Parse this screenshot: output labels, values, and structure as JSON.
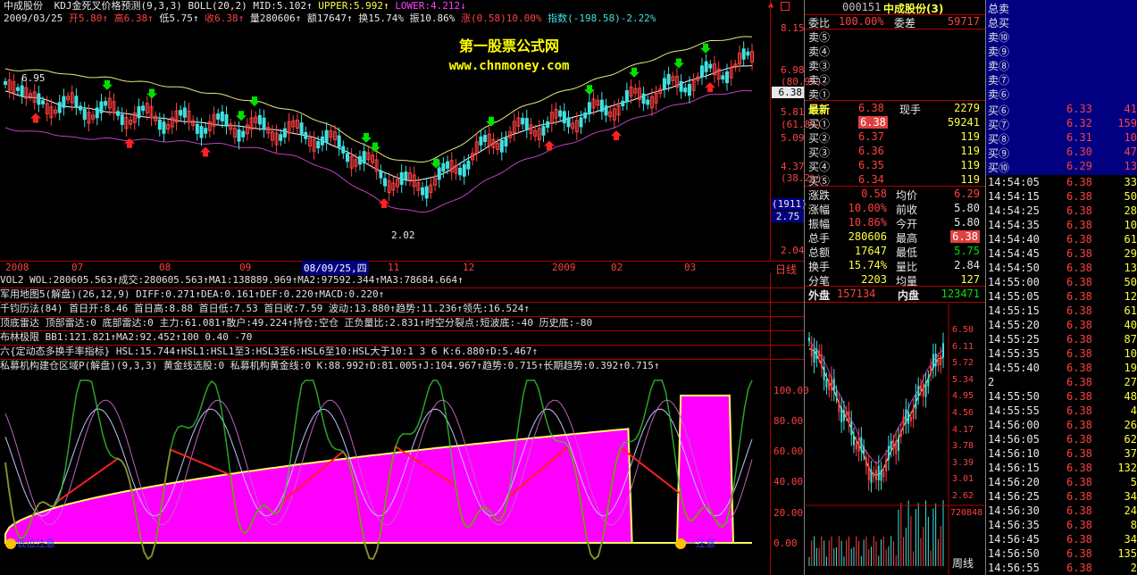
{
  "header": {
    "stock_name": "中成股份",
    "indicator_title": "KDJ金死叉价格预测(9,3,3)",
    "boll": "BOLL(20,2)",
    "mid": "MID:5.102",
    "upper": "UPPER:5.992",
    "lower": "LOWER:4.212",
    "date": "2009/03/25",
    "open": "开5.80",
    "high": "高6.38",
    "low": "低5.75",
    "close": "收6.38",
    "volume": "量280606",
    "amount": "额17647",
    "turnover": "换15.74%",
    "amplitude": "振10.86%",
    "change": "涨(0.58)10.00%",
    "index": "指数(-198.58)-2.22%"
  },
  "watermark": {
    "line1": "第一股票公式网",
    "line2": "www.chnmoney.com"
  },
  "main_chart": {
    "high_label": "6.95",
    "low_label": "2.02",
    "price_axis": [
      "8.15",
      "6.98",
      "(80.9%)",
      "6.38",
      "5.81",
      "(61.8%)",
      "5.09",
      "4.37",
      "(38.2%)",
      "(1911)",
      "2.75",
      "2.04"
    ],
    "time_axis": [
      "2008",
      "07",
      "08",
      "09",
      "08/09/25,四",
      "11",
      "12",
      "2009",
      "02",
      "03"
    ],
    "period": "日线"
  },
  "indicator_lines": [
    "VOL2 WOL:280605.563↑成交:280605.563↑MA1:138889.969↑MA2:97592.344↑MA3:78684.664↑",
    "军用地图5(解盘)(26,12,9) DIFF:0.271↑DEA:0.161↑DEF:0.220↑MACD:0.220↑",
    "千钧历法(84) 首日开:8.46 首日高:8.88 首日低:7.53 首日收:7.59 波动:13.880↑趋势:11.236↑领先:16.524↑",
    "顶底雷达 顶部雷达:0 底部雷达:0 主力:61.081↑散户:49.224↑持仓:空仓 正负量比:2.831↑时空分裂点:短波底:-40 历史底:-80",
    "布林极限 BB1:121.821↑MA2:92.452↑100 0.40 -70",
    "六{定动态多换手率指标} HSL:15.744↑HSL1:HSL1至3:HSL3至6:HSL6至10:HSL大于10:1 3 6 K:6.880↑D:5.467↑",
    "私募机构建仓区域P(解盘)(9,3,3) 黄金线选股:0 私募机构黄金线:0 K:88.992↑D:81.005↑J:104.967↑趋势:0.715↑长期趋势:0.392↑0.715↑"
  ],
  "lower_chart": {
    "axis": [
      "100.00",
      "80.00",
      "60.00",
      "40.00",
      "20.00",
      "0.00"
    ],
    "badge1": "低位注意",
    "badge2": "一注意"
  },
  "quote": {
    "code": "000151",
    "name": "中成股份(3)",
    "weibi_label": "委比",
    "weibi": "100.00%",
    "weicha_label": "委差",
    "weicha": "59717",
    "sells": [
      {
        "label": "卖⑤"
      },
      {
        "label": "卖④"
      },
      {
        "label": "卖③"
      },
      {
        "label": "卖②"
      },
      {
        "label": "卖①"
      }
    ],
    "last_label": "最新",
    "last": "6.38",
    "xianshou_label": "现手",
    "xianshou": "2279",
    "buys": [
      {
        "label": "买①",
        "price": "6.38",
        "vol": "59241"
      },
      {
        "label": "买②",
        "price": "6.37",
        "vol": "119"
      },
      {
        "label": "买③",
        "price": "6.36",
        "vol": "119"
      },
      {
        "label": "买④",
        "price": "6.35",
        "vol": "119"
      },
      {
        "label": "买⑤",
        "price": "6.34",
        "vol": "119"
      }
    ],
    "stats": [
      {
        "l1": "涨跌",
        "v1": "0.58",
        "l2": "均价",
        "v2": "6.29"
      },
      {
        "l1": "涨幅",
        "v1": "10.00%",
        "l2": "前收",
        "v2": "5.80"
      },
      {
        "l1": "振幅",
        "v1": "10.86%",
        "l2": "今开",
        "v2": "5.80"
      },
      {
        "l1": "总手",
        "v1": "280606",
        "l2": "最高",
        "v2": "6.38"
      },
      {
        "l1": "总额",
        "v1": "17647",
        "l2": "最低",
        "v2": "5.75"
      },
      {
        "l1": "换手",
        "v1": "15.74%",
        "l2": "量比",
        "v2": "2.84"
      },
      {
        "l1": "分笔",
        "v1": "2203",
        "l2": "均量",
        "v2": "127"
      }
    ],
    "waipan_label": "外盘",
    "waipan": "157134",
    "neipan_label": "内盘",
    "neipan": "123471"
  },
  "mini_chart": {
    "axis": [
      "6.50",
      "6.11",
      "5.72",
      "5.34",
      "4.95",
      "4.56",
      "4.17",
      "3.78",
      "3.39",
      "3.01",
      "2.62"
    ],
    "vol_label": "720848",
    "period": "周线"
  },
  "depth": {
    "total_sell": "总卖",
    "total_buy": "总买",
    "sells": [
      "卖⑩",
      "卖⑨",
      "卖⑧",
      "卖⑦",
      "卖⑥"
    ],
    "buys": [
      {
        "label": "买⑥",
        "price": "6.33",
        "vol": "41"
      },
      {
        "label": "买⑦",
        "price": "6.32",
        "vol": "159"
      },
      {
        "label": "买⑧",
        "price": "6.31",
        "vol": "10"
      },
      {
        "label": "买⑨",
        "price": "6.30",
        "vol": "47"
      },
      {
        "label": "买⑩",
        "price": "6.29",
        "vol": "13"
      }
    ]
  },
  "ticks": [
    {
      "t": "14:54:05",
      "p": "6.38",
      "v": "33"
    },
    {
      "t": "14:54:15",
      "p": "6.38",
      "v": "50"
    },
    {
      "t": "14:54:25",
      "p": "6.38",
      "v": "28"
    },
    {
      "t": "14:54:35",
      "p": "6.38",
      "v": "10"
    },
    {
      "t": "14:54:40",
      "p": "6.38",
      "v": "61"
    },
    {
      "t": "14:54:45",
      "p": "6.38",
      "v": "29"
    },
    {
      "t": "14:54:50",
      "p": "6.38",
      "v": "13"
    },
    {
      "t": "14:55:00",
      "p": "6.38",
      "v": "50"
    },
    {
      "t": "14:55:05",
      "p": "6.38",
      "v": "12"
    },
    {
      "t": "14:55:15",
      "p": "6.38",
      "v": "61"
    },
    {
      "t": "14:55:20",
      "p": "6.38",
      "v": "40"
    },
    {
      "t": "14:55:25",
      "p": "6.38",
      "v": "87"
    },
    {
      "t": "14:55:35",
      "p": "6.38",
      "v": "10"
    },
    {
      "t": "14:55:40",
      "p": "6.38",
      "v": "19"
    },
    {
      "t": "2",
      "p": "6.38",
      "v": "27"
    },
    {
      "t": "14:55:50",
      "p": "6.38",
      "v": "48"
    },
    {
      "t": "14:55:55",
      "p": "6.38",
      "v": "4"
    },
    {
      "t": "14:56:00",
      "p": "6.38",
      "v": "26"
    },
    {
      "t": "14:56:05",
      "p": "6.38",
      "v": "62"
    },
    {
      "t": "14:56:10",
      "p": "6.38",
      "v": "37"
    },
    {
      "t": "14:56:15",
      "p": "6.38",
      "v": "132"
    },
    {
      "t": "14:56:20",
      "p": "6.38",
      "v": "5"
    },
    {
      "t": "14:56:25",
      "p": "6.38",
      "v": "34"
    },
    {
      "t": "14:56:30",
      "p": "6.38",
      "v": "24"
    },
    {
      "t": "14:56:35",
      "p": "6.38",
      "v": "8"
    },
    {
      "t": "14:56:45",
      "p": "6.38",
      "v": "34"
    },
    {
      "t": "14:56:50",
      "p": "6.38",
      "v": "135"
    },
    {
      "t": "14:56:55",
      "p": "6.38",
      "v": "2"
    }
  ]
}
